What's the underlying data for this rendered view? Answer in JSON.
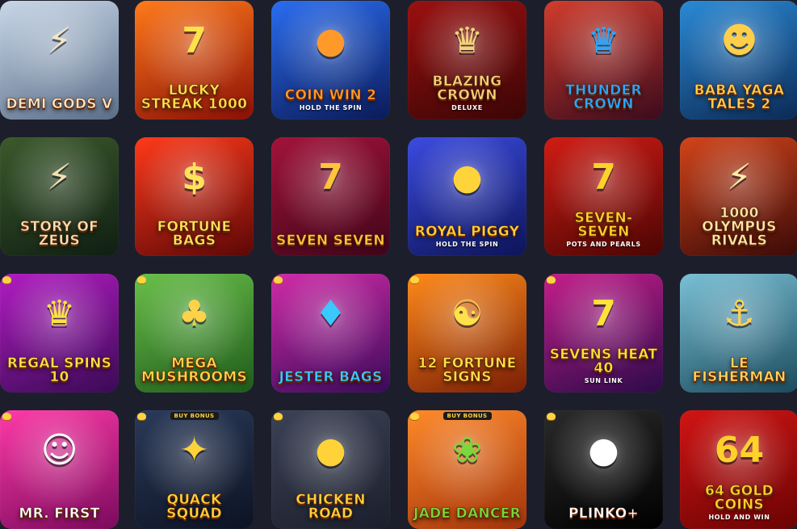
{
  "games": [
    {
      "title": "Demi Gods V",
      "sub": "",
      "badge": "",
      "art": "⚡",
      "bg": [
        "#c9d7e8",
        "#5a6e89"
      ],
      "title_color": "#f3e6c8"
    },
    {
      "title": "Lucky Streak 1000",
      "sub": "",
      "badge": "",
      "art": "7",
      "bg": [
        "#ff7a1a",
        "#8b0f07"
      ],
      "title_color": "#ffe14a"
    },
    {
      "title": "Coin Win 2",
      "sub": "HOLD THE SPIN",
      "badge": "",
      "art": "●",
      "bg": [
        "#2a6df0",
        "#0b1a58"
      ],
      "title_color": "#ff9a2a"
    },
    {
      "title": "Blazing Crown",
      "sub": "deluxe",
      "badge": "",
      "art": "♛",
      "bg": [
        "#9b1010",
        "#3a0505"
      ],
      "title_color": "#f2d27a"
    },
    {
      "title": "Thunder Crown",
      "sub": "",
      "badge": "",
      "art": "♛",
      "bg": [
        "#d23c2c",
        "#3b0b1d"
      ],
      "title_color": "#2aa8ff"
    },
    {
      "title": "Baba Yaga Tales 2",
      "sub": "",
      "badge": "",
      "art": "☻",
      "bg": [
        "#2a8ad6",
        "#0c2a55"
      ],
      "title_color": "#ffcf4a"
    },
    {
      "title": "Story of Zeus",
      "sub": "",
      "badge": "",
      "art": "⚡",
      "bg": [
        "#3c5a2c",
        "#0f1e12"
      ],
      "title_color": "#f1e2b3"
    },
    {
      "title": "Fortune Bags",
      "sub": "",
      "badge": "",
      "art": "$",
      "bg": [
        "#ff3a1a",
        "#5c0707"
      ],
      "title_color": "#ffe35a"
    },
    {
      "title": "Seven Seven",
      "sub": "",
      "badge": "",
      "art": "7",
      "bg": [
        "#a3133a",
        "#3f0519"
      ],
      "title_color": "#ffc53a"
    },
    {
      "title": "Royal Piggy",
      "sub": "HOLD THE SPIN",
      "badge": "",
      "art": "●",
      "bg": [
        "#3b4be0",
        "#0d1458"
      ],
      "title_color": "#ffd43a"
    },
    {
      "title": "Seven-Seven",
      "sub": "POTS AND PEARLS",
      "badge": "",
      "art": "7",
      "bg": [
        "#d21c14",
        "#4a0503"
      ],
      "title_color": "#ffd22a"
    },
    {
      "title": "1000 Olympus Rivals",
      "sub": "",
      "badge": "",
      "art": "⚡",
      "bg": [
        "#d2441a",
        "#3b0a08"
      ],
      "title_color": "#ffe9a8"
    },
    {
      "title": "Regal Spins 10",
      "sub": "",
      "badge": "",
      "art": "♛",
      "bg": [
        "#b21cc2",
        "#3a0a55"
      ],
      "title_color": "#ffe14a"
    },
    {
      "title": "Mega Mushrooms",
      "sub": "",
      "badge": "",
      "art": "♣",
      "bg": [
        "#6ac04a",
        "#1e5a1a"
      ],
      "title_color": "#ffd24a"
    },
    {
      "title": "Jester Bags",
      "sub": "",
      "badge": "",
      "art": "♦",
      "bg": [
        "#d12ba8",
        "#3a0a5a"
      ],
      "title_color": "#3ac8ff"
    },
    {
      "title": "12 Fortune Signs",
      "sub": "",
      "badge": "",
      "art": "☯",
      "bg": [
        "#ff8a1a",
        "#7a1e05"
      ],
      "title_color": "#ffe14a"
    },
    {
      "title": "Sevens Heat 40",
      "sub": "SUN LINK",
      "badge": "",
      "art": "7",
      "bg": [
        "#c51e8a",
        "#2c0a4a"
      ],
      "title_color": "#ffe23a"
    },
    {
      "title": "Le Fisherman",
      "sub": "",
      "badge": "",
      "art": "⚓",
      "bg": [
        "#7ac0d6",
        "#1b4a5c"
      ],
      "title_color": "#ffd35a"
    },
    {
      "title": "Mr. First",
      "sub": "",
      "badge": "",
      "art": "☺",
      "bg": [
        "#ff3aa8",
        "#7a0a5c"
      ],
      "title_color": "#ffffff"
    },
    {
      "title": "Quack Squad",
      "sub": "",
      "badge": "BUY BONUS",
      "art": "✦",
      "bg": [
        "#2a3a5a",
        "#0c1222"
      ],
      "title_color": "#ffd23a"
    },
    {
      "title": "Chicken Road",
      "sub": "",
      "badge": "",
      "art": "●",
      "bg": [
        "#3c4256",
        "#1b1f2c"
      ],
      "title_color": "#ffd23a"
    },
    {
      "title": "Jade Dancer",
      "sub": "",
      "badge": "BUY BONUS",
      "art": "❀",
      "bg": [
        "#ff8a2a",
        "#a2320a"
      ],
      "title_color": "#7ad83a"
    },
    {
      "title": "Plinko+",
      "sub": "",
      "badge": "",
      "art": "●",
      "bg": [
        "#2a2a2a",
        "#000000"
      ],
      "title_color": "#ffffff"
    },
    {
      "title": "64 Gold Coins",
      "sub": "HOLD AND WIN",
      "badge": "",
      "art": "64",
      "bg": [
        "#d21414",
        "#6a0303"
      ],
      "title_color": "#ffd22a"
    }
  ],
  "theme": {
    "page_background": "#1c1f2b"
  }
}
